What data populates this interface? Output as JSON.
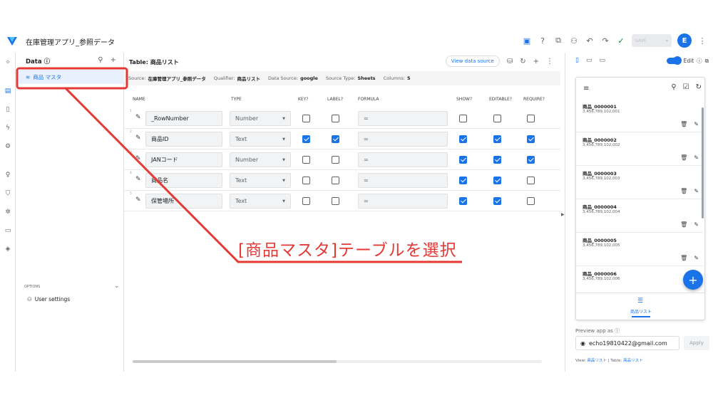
{
  "app": {
    "title": "在庫管理アプリ_参照データ",
    "save_label": "SAVE",
    "avatar_letter": "E"
  },
  "data_panel": {
    "title": "Data",
    "table_item": "商品 マスタ",
    "options_label": "OPTIONS",
    "user_settings": "User settings"
  },
  "table": {
    "title": "Table: 商品リスト",
    "view_source": "View data source",
    "meta": {
      "source_label": "Source:",
      "source": "在庫管理アプリ_参照データ",
      "qualifier_label": "Qualifier:",
      "qualifier": "商品リスト",
      "data_source_label": "Data Source:",
      "data_source": "google",
      "source_type_label": "Source Type:",
      "source_type": "Sheets",
      "columns_label": "Columns:",
      "columns": "5"
    },
    "headers": {
      "name": "NAME",
      "type": "TYPE",
      "key": "KEY?",
      "label": "LABEL?",
      "formula": "FORMULA",
      "show": "SHOW?",
      "editable": "EDITABLE?",
      "require": "REQUIRE?"
    },
    "rows": [
      {
        "num": "1",
        "name": "_RowNumber",
        "type": "Number",
        "key": false,
        "label": false,
        "formula": "=",
        "show": false,
        "editable": false,
        "require": false
      },
      {
        "num": "2",
        "name": "商品ID",
        "type": "Text",
        "key": true,
        "label": true,
        "formula": "=",
        "show": true,
        "editable": true,
        "require": true
      },
      {
        "num": "3",
        "name": "JANコード",
        "type": "Number",
        "key": false,
        "label": false,
        "formula": "=",
        "show": true,
        "editable": true,
        "require": true
      },
      {
        "num": "4",
        "name": "商品名",
        "type": "Text",
        "key": false,
        "label": false,
        "formula": "=",
        "show": true,
        "editable": true,
        "require": false
      },
      {
        "num": "5",
        "name": "保管場所",
        "type": "Text",
        "key": false,
        "label": false,
        "formula": "=",
        "show": true,
        "editable": true,
        "require": false
      }
    ]
  },
  "preview": {
    "edit_label": "Edit",
    "cards": [
      {
        "title": "商品_0000001",
        "sub": "3,456,789,102,001"
      },
      {
        "title": "商品_0000002",
        "sub": "3,456,789,102,002"
      },
      {
        "title": "商品_0000003",
        "sub": "3,456,789,102,003"
      },
      {
        "title": "商品_0000004",
        "sub": "3,456,789,102,004"
      },
      {
        "title": "商品_0000005",
        "sub": "3,456,789,102,005"
      },
      {
        "title": "商品_0000006",
        "sub": "3,456,789,102,006"
      }
    ],
    "nav_label": "商品リスト",
    "preview_as": "Preview app as",
    "email": "echo19810422@gmail.com",
    "apply": "Apply",
    "view_label": "View:",
    "view_value": "商品リスト",
    "table_label": "Table:",
    "table_value": "商品リスト"
  },
  "annotation": {
    "text": "[商品マスタ]テーブルを選択",
    "color": "#e53935"
  }
}
